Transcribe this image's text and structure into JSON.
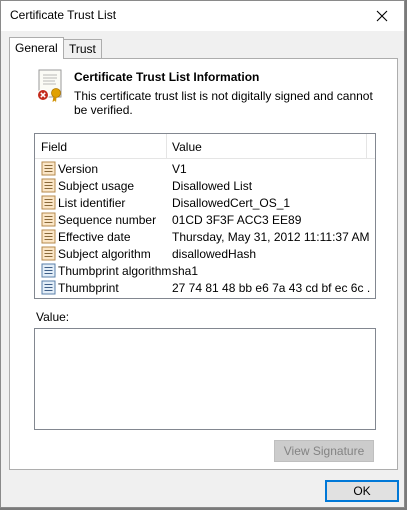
{
  "window": {
    "title": "Certificate Trust List"
  },
  "tabs": [
    {
      "label": "General",
      "active": true
    },
    {
      "label": "Trust List",
      "active": false
    }
  ],
  "info": {
    "title": "Certificate Trust List Information",
    "description": "This certificate trust list is not digitally signed and cannot be verified."
  },
  "details": {
    "columns": [
      "Field",
      "Value"
    ],
    "rows": [
      {
        "field": "Version",
        "value": "V1",
        "icon": "property-icon"
      },
      {
        "field": "Subject usage",
        "value": "Disallowed List",
        "icon": "property-icon"
      },
      {
        "field": "List identifier",
        "value": "DisallowedCert_OS_1",
        "icon": "property-icon"
      },
      {
        "field": "Sequence number",
        "value": "01CD 3F3F ACC3 EE89",
        "icon": "property-icon"
      },
      {
        "field": "Effective date",
        "value": "Thursday, May 31, 2012 11:11:37 AM",
        "icon": "property-icon"
      },
      {
        "field": "Subject algorithm",
        "value": "disallowedHash",
        "icon": "property-icon"
      },
      {
        "field": "Thumbprint algorithm",
        "value": "sha1",
        "icon": "thumbprint-icon"
      },
      {
        "field": "Thumbprint",
        "value": "27 74 81 48 bb e6 7a 43 cd bf ec 6c ...",
        "icon": "thumbprint-icon"
      }
    ]
  },
  "value_section": {
    "label": "Value:",
    "content": ""
  },
  "buttons": {
    "view_signature": "View Signature",
    "ok": "OK"
  },
  "colors": {
    "accent": "#0078d7",
    "error": "#c42b1c",
    "ribbon": "#e0a000"
  }
}
